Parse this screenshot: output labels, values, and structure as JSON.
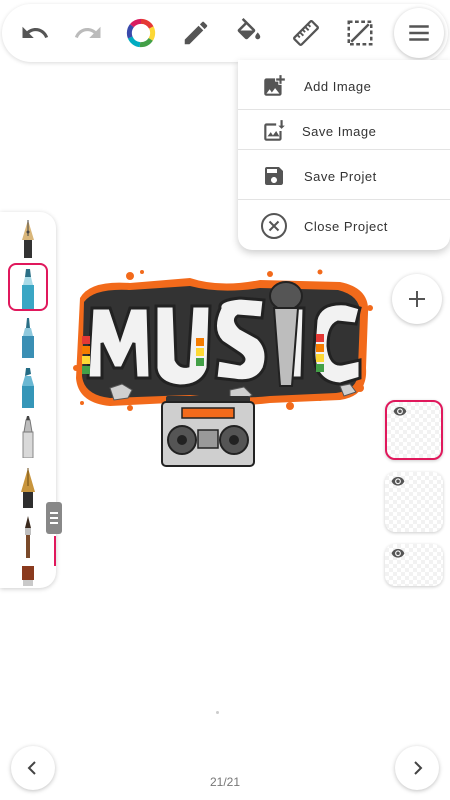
{
  "toolbar": {
    "buttons": [
      {
        "name": "undo-icon"
      },
      {
        "name": "redo-icon"
      },
      {
        "name": "color-wheel-icon"
      },
      {
        "name": "pencil-icon"
      },
      {
        "name": "fill-bucket-icon"
      },
      {
        "name": "ruler-icon"
      },
      {
        "name": "selection-icon"
      },
      {
        "name": "menu-icon"
      }
    ]
  },
  "menu": {
    "items": [
      {
        "label": "Add Image",
        "icon": "add-image-icon"
      },
      {
        "label": "Save Image",
        "icon": "save-image-icon"
      },
      {
        "label": "Save Projet",
        "icon": "save-project-icon"
      },
      {
        "label": "Close Project",
        "icon": "close-icon"
      }
    ]
  },
  "brushes": [
    {
      "name": "fountain-pen-brush"
    },
    {
      "name": "marker-teal-brush",
      "selected": true
    },
    {
      "name": "marker-blue-brush"
    },
    {
      "name": "highlighter-brush"
    },
    {
      "name": "chisel-brush"
    },
    {
      "name": "gold-nib-brush"
    },
    {
      "name": "paint-brush"
    },
    {
      "name": "flat-brush"
    }
  ],
  "artwork": {
    "text": "MUSIC"
  },
  "layers": [
    {
      "visible": true,
      "selected": true
    },
    {
      "visible": true,
      "selected": false
    },
    {
      "visible": true,
      "selected": false
    }
  ],
  "pager": {
    "indicator": "21/21"
  },
  "colors": {
    "accent": "#e0185c",
    "orange": "#f26a1b",
    "teal": "#3aa6c4"
  }
}
